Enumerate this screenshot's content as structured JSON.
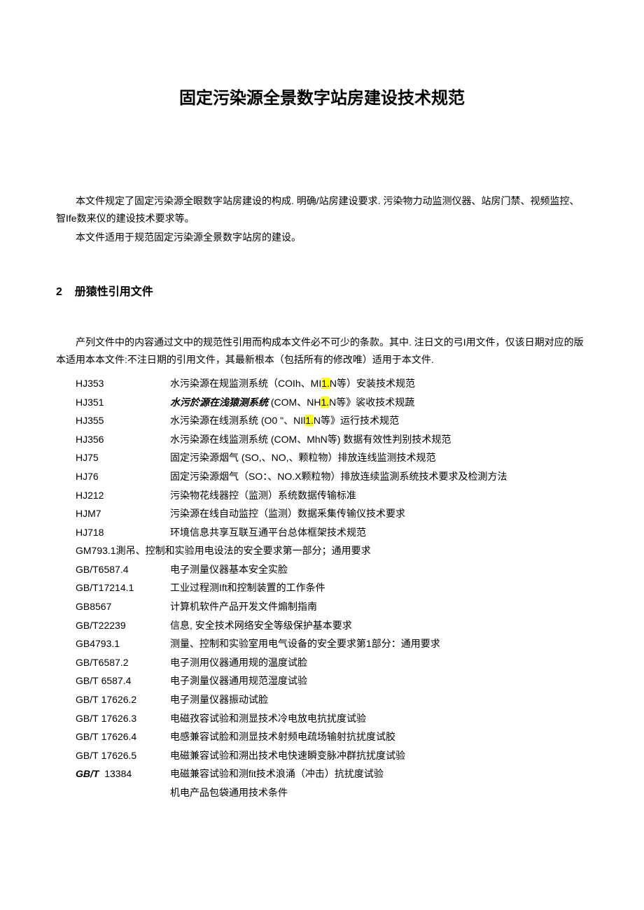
{
  "title": "固定污染源全景数字站房建设技术规范",
  "intro": {
    "p1": "本文件规定了固定污染源全眼数字站房建设的构成. 明确/站房建设要求. 污染物力动监测仪器、站房门禁、视频监控、智Ife数来仪的建设技术要求等。",
    "p2": "本文件适用于规范固定污染源全景数字站房的建设。"
  },
  "section2": {
    "num": "2",
    "heading": "册猿性引用文件",
    "lead": "产列文件中的内容通过文中的规范性引用而构成本文件必不可少的条款。其中. 注日文的弓I用文件，仅该日期对应的版本适用本本文件:不注日期的引用文件，其最新根本（包括所有的修改唯）适用于本文件."
  },
  "refs_top": [
    {
      "code": "HJ353",
      "pre": "水污染源在规监测系统（COIh、MI",
      "hl": "1.",
      "post": "N等）安装技术规范"
    },
    {
      "code": "HJ351",
      "pre_italic": "水污於源在浅猿测系统 ",
      "mid": "(COM、NH",
      "hl": "1.",
      "post": "N等》裟收技术规蔬"
    },
    {
      "code": "HJ355",
      "pre": "水污染源在线测系统 (O0 \"、NIl",
      "hl": "1.",
      "post": "N等》运行技术规范"
    },
    {
      "code": "HJ356",
      "text": "水污染源在线监测系统 (COM、MhN等) 数据有效性判别技术规范"
    },
    {
      "code": "HJ75",
      "text": "固定污染源烟气 (SO,、NO,、颗粒物）排放连线监测技术规范"
    },
    {
      "code": "HJ76",
      "text": "固定污染源烟气（SO：、NO.X颗粒物）排放连续监測系统技术要求及检測方法"
    },
    {
      "code": "HJ212",
      "text": "污染物花线器控（监测）系统数据传输标准"
    },
    {
      "code": "HJM7",
      "text": "污染源在线自动监控（监测）数据釆集传输仪技术要求"
    },
    {
      "code": "HJ718",
      "text": "环境信息共享互联互通平台总体框架技术规范"
    }
  ],
  "gm_line": "GM793.1測吊、控制和实验用电设法的安全要求第一部分；通用要求",
  "refs_bottom": [
    {
      "code": "GB/T6587.4",
      "text": "电子测量仪器基本安全实脸"
    },
    {
      "code": "GB/T17214.1",
      "text": "工业过程测Ift和控制装置的工作条件"
    },
    {
      "code": "GB8567",
      "text": "计算机软件产品开发文件煽制指南"
    },
    {
      "code": "GB/T22239",
      "text": "信息, 安全技术网络安全等级保护基本要求"
    },
    {
      "code": "GB4793.1",
      "text": "测量、控制和实验室用电气设备的安全要求第1部分：通用要求"
    },
    {
      "code": "GB/T6587.2",
      "text": "电子测用仪器通用规的温度试脸"
    },
    {
      "code1": "GB/T",
      "code2": "6587.4",
      "text": "电子測量仪器通用规范湿度试验"
    },
    {
      "code1": "GB/T",
      "code2": "17626.2",
      "text": "电子测量仪器振动试脸"
    },
    {
      "code1": "GB/T",
      "code2": "17626.3",
      "text": "电磁孜容试验和测显技术冷电放电抗扰度试验"
    },
    {
      "code1": "GB/T",
      "code2": "17626.4",
      "text": "电感兼容试脸和测显技术射频电疏场输射抗扰度试胶"
    },
    {
      "code1": "GB/T",
      "code2": "17626.5",
      "text": "电磁兼容试验和溯出技术电快速瞬变脉冲群抗扰度试验"
    },
    {
      "code1_italic": "GB/T",
      "code2": "13384",
      "text": "电磁兼容试验和测fit技术浪涌（冲击）抗扰度试验"
    },
    {
      "spacer": true,
      "text": "机电产品包袋通用技术条件"
    }
  ]
}
